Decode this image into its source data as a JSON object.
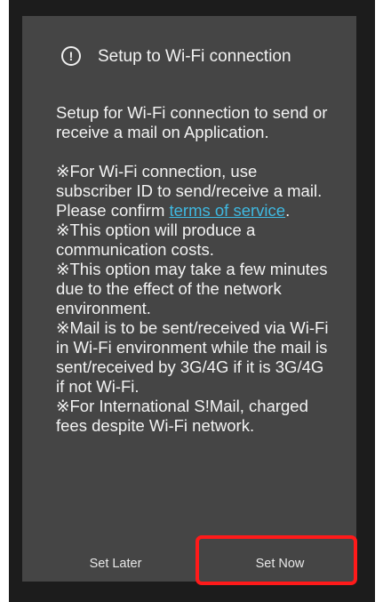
{
  "dialog": {
    "title": "Setup to Wi-Fi connection",
    "icon": "info-icon",
    "intro": "Setup for Wi-Fi connection to send or receive a mail on Application.",
    "note1_prefix": "※For Wi-Fi connection, use subscriber ID to send/receive a mail. Please confirm ",
    "note1_link": "terms of service",
    "note1_suffix": ".",
    "note2": "※This option will produce a communication costs.",
    "note3": "※This option may take a few minutes due to the effect of the network environment.",
    "note4": "※Mail is to be sent/received via Wi-Fi in Wi-Fi environment while the mail is sent/received by 3G/4G if it is 3G/4G if not Wi-Fi.",
    "note5": "※For International S!Mail, charged fees despite Wi-Fi network."
  },
  "buttons": {
    "set_later": "Set Later",
    "set_now": "Set Now"
  },
  "colors": {
    "dialog_bg": "#454545",
    "link": "#3fb8e0",
    "highlight": "#ff1a1a"
  }
}
